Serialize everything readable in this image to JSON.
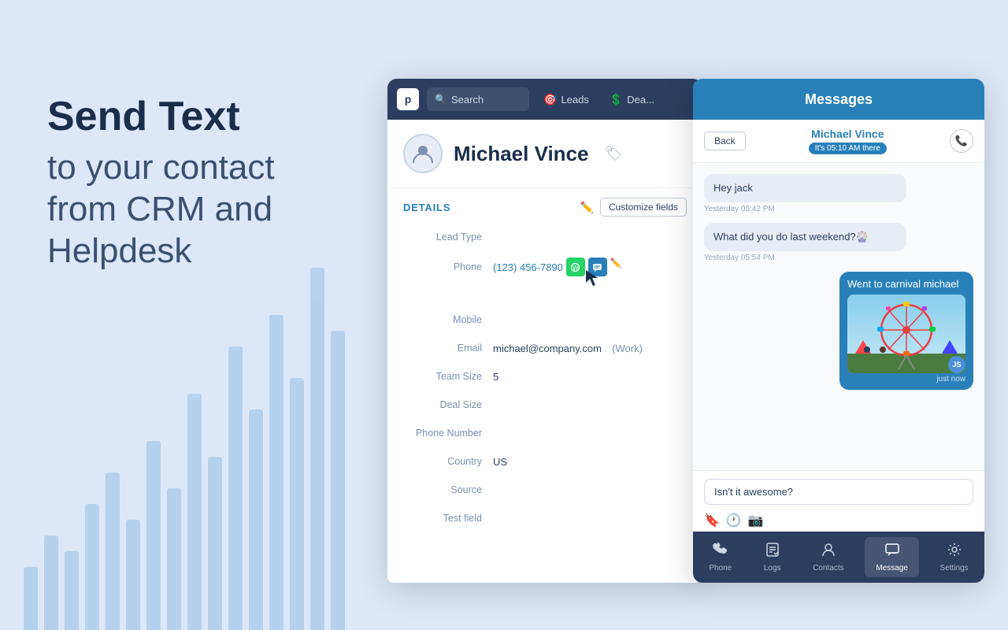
{
  "page": {
    "background_color": "#dce8f8"
  },
  "hero": {
    "title_bold": "Send Text",
    "title_normal": "to your contact\nfrom CRM and\nHelpdesk"
  },
  "crm": {
    "logo": "p",
    "search_placeholder": "Search",
    "nav_items": [
      {
        "icon": "🎯",
        "label": "Leads"
      },
      {
        "icon": "💲",
        "label": "Dea..."
      }
    ],
    "contact": {
      "name": "Michael Vince"
    },
    "details": {
      "section_label": "DETAILS",
      "customize_button": "Customize fields",
      "fields": [
        {
          "label": "Lead Type",
          "value": ""
        },
        {
          "label": "Phone",
          "value": "(123) 456-7890"
        },
        {
          "label": "Mobile",
          "value": ""
        },
        {
          "label": "Email",
          "value": "michael@company.com  (Work)"
        },
        {
          "label": "Team Size",
          "value": "5"
        },
        {
          "label": "Deal Size",
          "value": ""
        },
        {
          "label": "Phone Number",
          "value": ""
        },
        {
          "label": "Country",
          "value": "US"
        },
        {
          "label": "Source",
          "value": ""
        },
        {
          "label": "Test field",
          "value": ""
        }
      ]
    }
  },
  "messages": {
    "window_title": "Messages",
    "back_button": "Back",
    "contact_name": "Michael Vince",
    "contact_time": "It's 05:10 AM there",
    "chat": [
      {
        "type": "received",
        "text": "Hey jack",
        "time": "Yesterday 05:42 PM"
      },
      {
        "type": "received",
        "text": "What did you do last weekend?🎡",
        "time": "Yesterday 05:54 PM"
      },
      {
        "type": "sent_image",
        "text": "Went to carnival michael",
        "time": "just now"
      }
    ],
    "input_value": "Isn't it awesome?",
    "bottom_nav": [
      {
        "icon": "📞",
        "label": "Phone",
        "active": false
      },
      {
        "icon": "📋",
        "label": "Logs",
        "active": false
      },
      {
        "icon": "👤",
        "label": "Contacts",
        "active": false
      },
      {
        "icon": "💬",
        "label": "Message",
        "active": true
      },
      {
        "icon": "⚙️",
        "label": "Settings",
        "active": false
      }
    ]
  },
  "icons": {
    "search": "🔍",
    "tag": "🏷",
    "edit_pencil": "✏️",
    "whatsapp": "W",
    "sms": "💬",
    "phone_call": "📞",
    "bookmark": "🔖",
    "clock": "🕐",
    "camera": "📷",
    "cursor": "▲"
  }
}
